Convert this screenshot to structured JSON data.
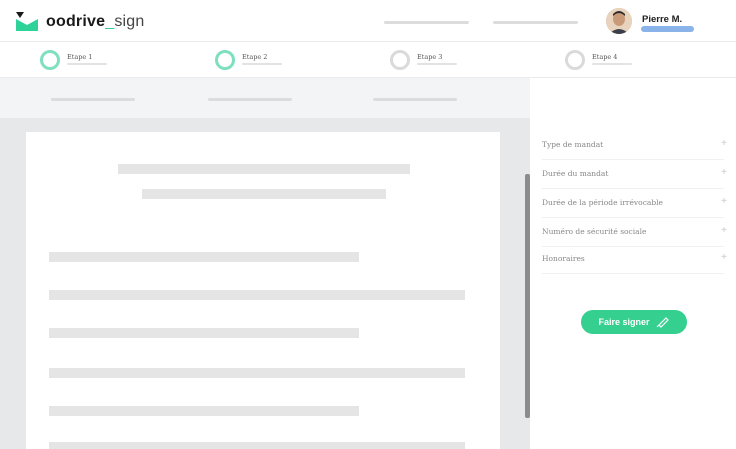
{
  "brand": {
    "name": "oodrive",
    "separator": "_",
    "product": "sign",
    "accent_color": "#2fd39a"
  },
  "user": {
    "name": "Pierre M.",
    "avatar_icon": "user-avatar"
  },
  "steps": [
    {
      "label": "Etape 1",
      "active": true
    },
    {
      "label": "Etape 2",
      "active": true
    },
    {
      "label": "Etape 3",
      "active": false
    },
    {
      "label": "Etape 4",
      "active": false
    }
  ],
  "fields": [
    {
      "label": "Type de mandat",
      "icon": "plus-icon",
      "action": "+"
    },
    {
      "label": "Durée du mandat",
      "icon": "plus-icon",
      "action": "+"
    },
    {
      "label": "Durée de la période irrévocable",
      "icon": "plus-icon",
      "action": "+"
    },
    {
      "label": "Numéro de sécurité sociale",
      "icon": "plus-icon",
      "action": "+"
    },
    {
      "label": "Honoraires",
      "icon": "plus-icon",
      "action": "+"
    }
  ],
  "sign_button": {
    "label": "Faire signer",
    "icon": "pen-icon",
    "color": "#35cf8f"
  }
}
